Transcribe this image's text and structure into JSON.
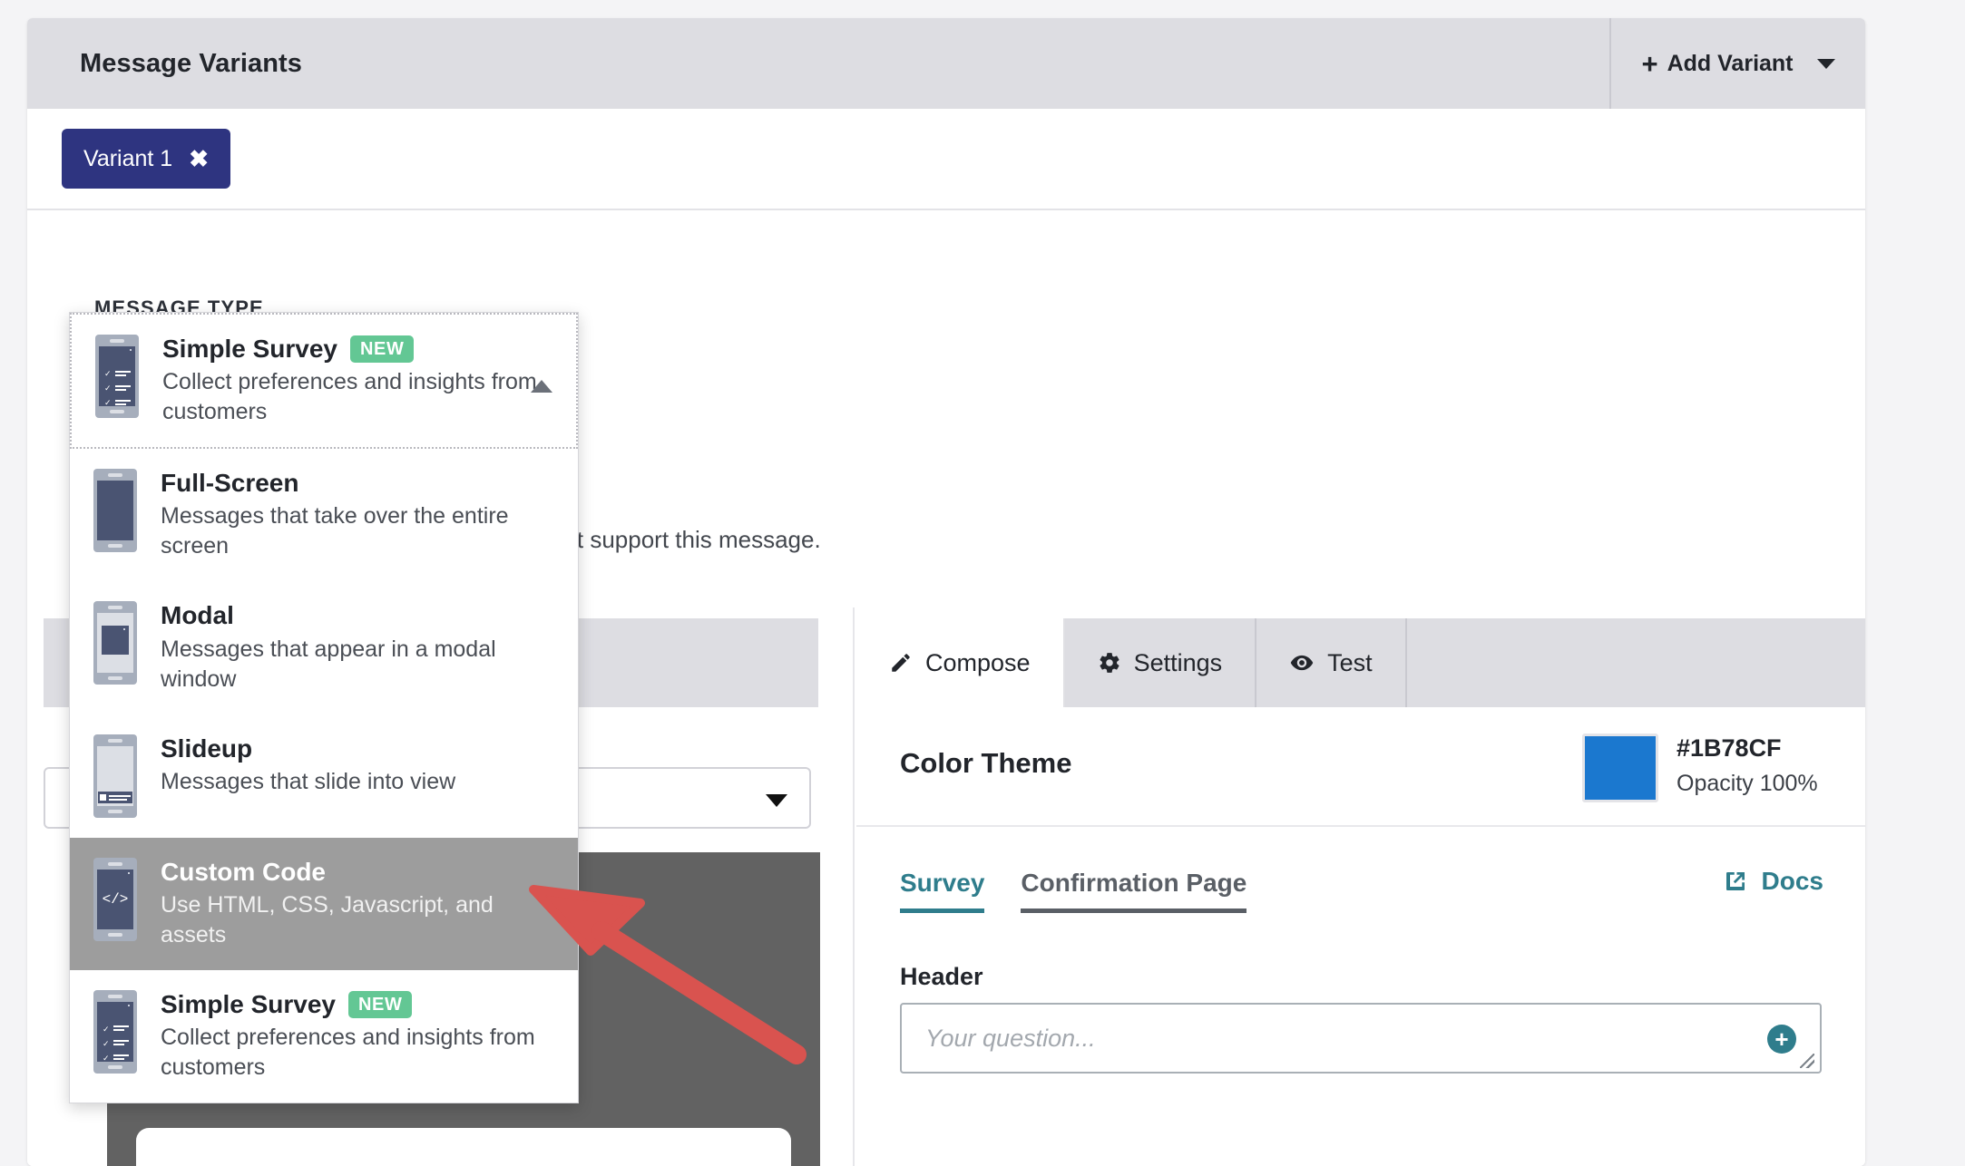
{
  "header": {
    "title": "Message Variants",
    "add_variant_label": "Add Variant",
    "plus_glyph": "+"
  },
  "variants": {
    "chip_label": "Variant 1",
    "close_glyph": "✖"
  },
  "message_type": {
    "section_label": "MESSAGE TYPE",
    "selected": {
      "title": "Simple Survey",
      "badge": "NEW",
      "description": "Collect preferences and insights from customers",
      "icon": "phone-survey-icon"
    },
    "options": [
      {
        "title": "Full-Screen",
        "badge": "",
        "description": "Messages that take over the entire screen",
        "icon": "phone-fullscreen-icon",
        "highlighted": false
      },
      {
        "title": "Modal",
        "badge": "",
        "description": "Messages that appear in a modal window",
        "icon": "phone-modal-icon",
        "highlighted": false
      },
      {
        "title": "Slideup",
        "badge": "",
        "description": "Messages that slide into view",
        "icon": "phone-slideup-icon",
        "highlighted": false
      },
      {
        "title": "Custom Code",
        "badge": "",
        "description": "Use HTML, CSS, Javascript, and assets",
        "icon": "phone-code-icon",
        "highlighted": true
      },
      {
        "title": "Simple Survey",
        "badge": "NEW",
        "description": "Collect preferences and insights from customers",
        "icon": "phone-survey-icon",
        "highlighted": false
      }
    ]
  },
  "description_text": {
    "link_fragment": "s",
    "rest": " that do not support this message."
  },
  "tabs": [
    {
      "label": "Compose",
      "icon": "pencil-icon",
      "active": true
    },
    {
      "label": "Settings",
      "icon": "gear-icon",
      "active": false
    },
    {
      "label": "Test",
      "icon": "eye-icon",
      "active": false
    }
  ],
  "color_theme": {
    "label": "Color Theme",
    "hex": "#1B78CF",
    "swatch_color": "#1B78CF",
    "opacity": "Opacity 100%"
  },
  "sub_tabs": [
    {
      "label": "Survey",
      "active": true
    },
    {
      "label": "Confirmation Page",
      "active": false
    }
  ],
  "docs": {
    "label": "Docs",
    "icon": "external-link-icon"
  },
  "header_field": {
    "label": "Header",
    "placeholder": "Your question...",
    "value": "",
    "add_icon": "plus-circle-icon"
  },
  "annotation": {
    "color": "#d9534f",
    "type": "arrow"
  }
}
